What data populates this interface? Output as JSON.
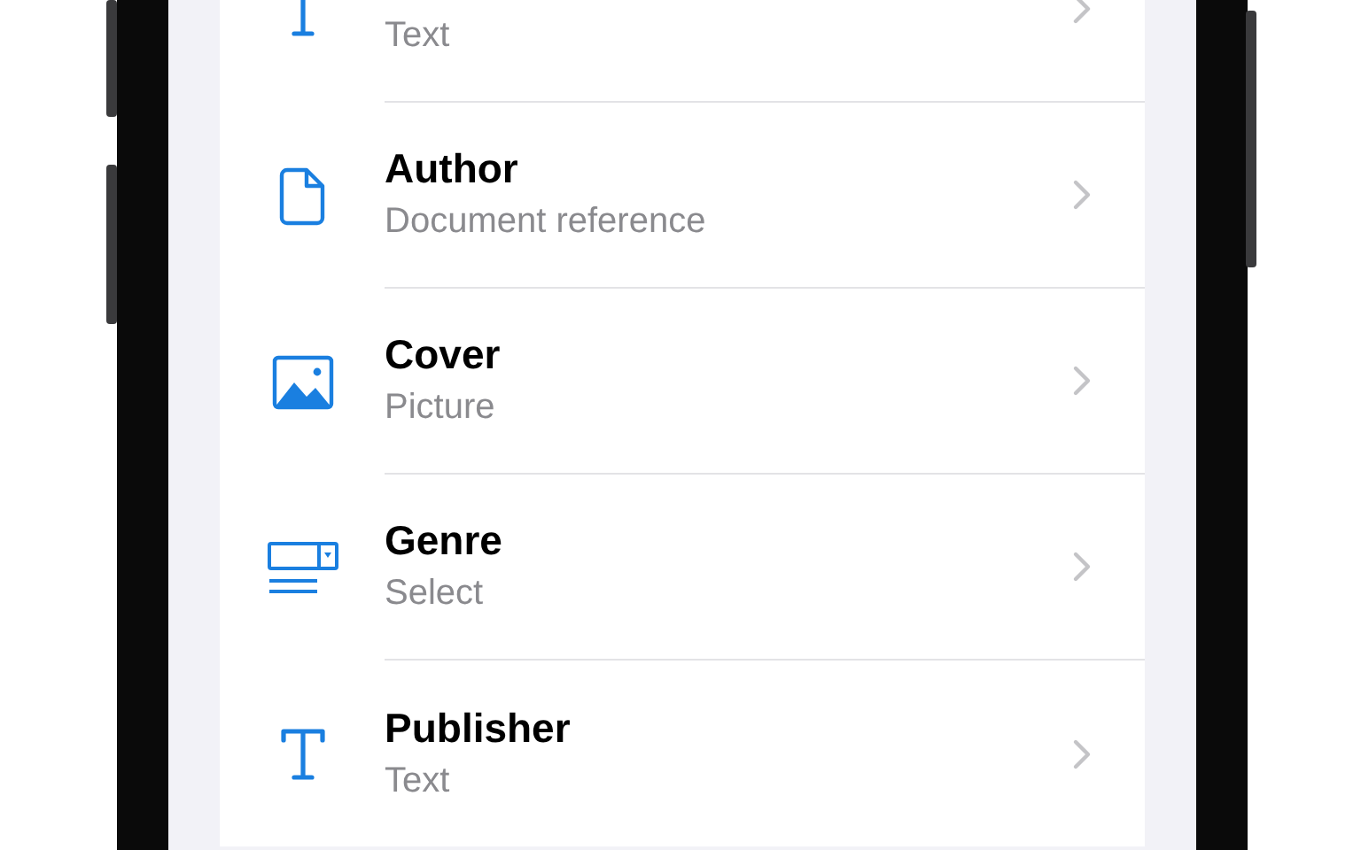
{
  "fields": [
    {
      "kind": "text",
      "subtitle": "Text"
    },
    {
      "kind": "document",
      "title": "Author",
      "subtitle": "Document reference"
    },
    {
      "kind": "picture",
      "title": "Cover",
      "subtitle": "Picture"
    },
    {
      "kind": "select",
      "title": "Genre",
      "subtitle": "Select"
    },
    {
      "kind": "text",
      "title": "Publisher",
      "subtitle": "Text"
    }
  ]
}
